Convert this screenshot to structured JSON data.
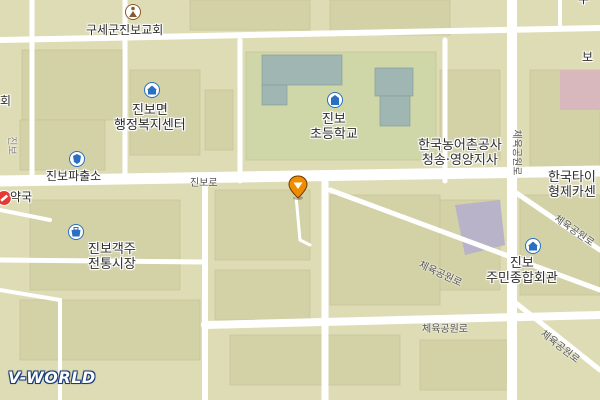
{
  "places": {
    "church": "구세군진보교회",
    "welfare_center": "진보면\n행정복지센터",
    "school": "진보\n초등학교",
    "police": "진보파출소",
    "pharmacy": "약국",
    "market": "진보객주\n전통시장",
    "agri_office": "한국농어촌공사\n청송·영양지사",
    "community_center": "진보\n주민종합회관",
    "tire": "한국타이\n형제카센",
    "edge_top_left": "회",
    "edge_top_right": "보",
    "edge_top_far_right": "우",
    "edge_left_mid": "진보"
  },
  "roads": {
    "main_road": "진보로",
    "park_road_1": "체육공원로",
    "park_road_2": "체육공원로",
    "park_road_3": "체육공원로",
    "park_road_4": "체육공원로",
    "park_road_5": "체육공원로"
  },
  "icons": {
    "church": "church-icon",
    "welfare_center": "government-office-icon",
    "school": "school-icon",
    "police": "police-icon",
    "pharmacy": "pharmacy-icon",
    "market": "market-icon",
    "community_center": "community-center-icon",
    "marker": "location-pin-icon"
  },
  "colors": {
    "land": "#dedcb4",
    "road": "#ffffff",
    "poi_blue": "#2a6fc0",
    "marker_orange": "#f08c00"
  },
  "brand": {
    "logo": "V-WORLD"
  }
}
